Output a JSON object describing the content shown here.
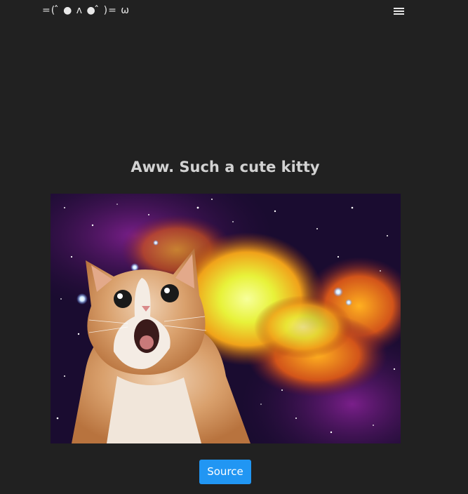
{
  "navbar": {
    "brand": "=( ̂ ● ʌ ● ̂ )= ω",
    "menu_icon": "hamburger-menu-icon"
  },
  "main": {
    "headline": "Aww. Such a cute kitty",
    "image_alt": "Surprised cat in space",
    "source_label": "Source"
  },
  "colors": {
    "background": "#212121",
    "button": "#2196f3",
    "headline": "#d2d2d2"
  }
}
